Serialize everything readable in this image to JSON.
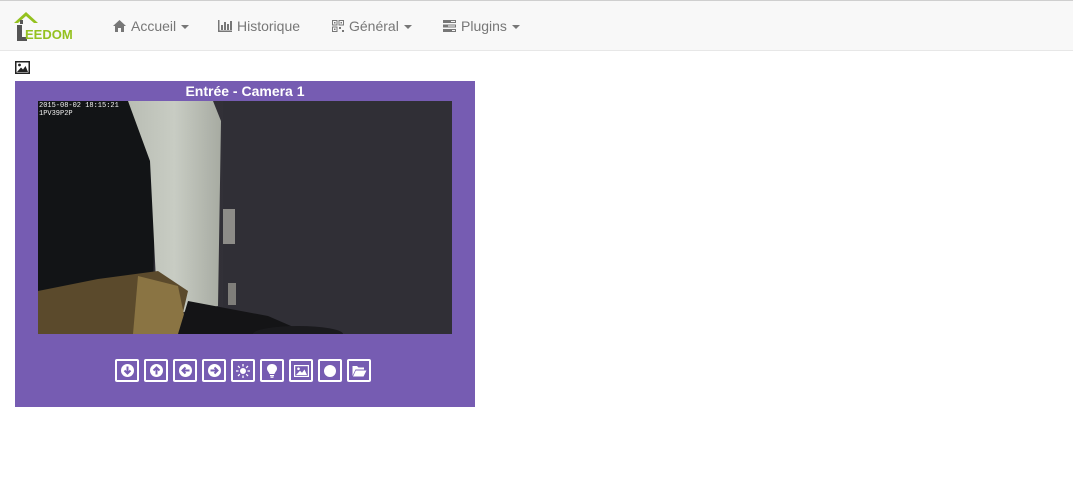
{
  "brand": {
    "name": "EEDOM",
    "logo_icon": "jeedom-house-logo"
  },
  "nav": {
    "items": [
      {
        "label": "Accueil",
        "icon": "home-icon",
        "dropdown": true
      },
      {
        "label": "Historique",
        "icon": "bar-chart-icon",
        "dropdown": false
      },
      {
        "label": "Général",
        "icon": "qrcode-icon",
        "dropdown": true
      },
      {
        "label": "Plugins",
        "icon": "tasks-icon",
        "dropdown": true
      }
    ]
  },
  "page": {
    "snapshot_icon": "picture-icon"
  },
  "widget": {
    "title": "Entrée - Camera 1",
    "background": "#765cb2",
    "camera": {
      "timestamp": "2015-08-02 18:15:21",
      "camera_id": "1PV39P2P"
    },
    "controls": [
      {
        "name": "arrow-down-button",
        "icon": "arrow-down-icon"
      },
      {
        "name": "arrow-up-button",
        "icon": "arrow-up-icon"
      },
      {
        "name": "arrow-left-button",
        "icon": "arrow-left-icon"
      },
      {
        "name": "arrow-right-button",
        "icon": "arrow-right-icon"
      },
      {
        "name": "brightness-button",
        "icon": "sun-icon"
      },
      {
        "name": "light-button",
        "icon": "lightbulb-icon"
      },
      {
        "name": "snapshot-button",
        "icon": "picture-icon"
      },
      {
        "name": "record-button",
        "icon": "record-circle-icon"
      },
      {
        "name": "folder-button",
        "icon": "folder-open-icon"
      }
    ]
  },
  "colors": {
    "accent": "#94c11f",
    "nav_text": "#777777",
    "navbar_bg": "#f8f8f8"
  }
}
